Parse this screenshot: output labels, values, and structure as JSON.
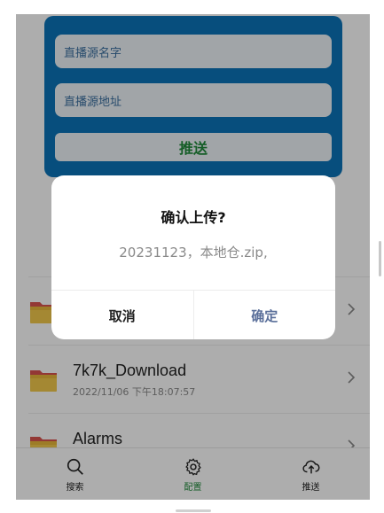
{
  "push_form": {
    "name_placeholder": "直播源名字",
    "url_placeholder": "直播源地址",
    "submit_label": "推送"
  },
  "files": [
    {
      "name": "",
      "date": ""
    },
    {
      "name": "7k7k_Download",
      "date": "2022/11/06 下午18:07:57"
    },
    {
      "name": "Alarms",
      "date": ""
    }
  ],
  "bottom_nav": {
    "search": "搜索",
    "config": "配置",
    "push": "推送"
  },
  "dialog": {
    "title": "确认上传?",
    "message": "20231123，本地仓.zip,",
    "cancel": "取消",
    "confirm": "确定"
  },
  "colors": {
    "accent": "#0b74b8",
    "active_nav": "#1f8a3a",
    "confirm_text": "#5a6f9a"
  }
}
